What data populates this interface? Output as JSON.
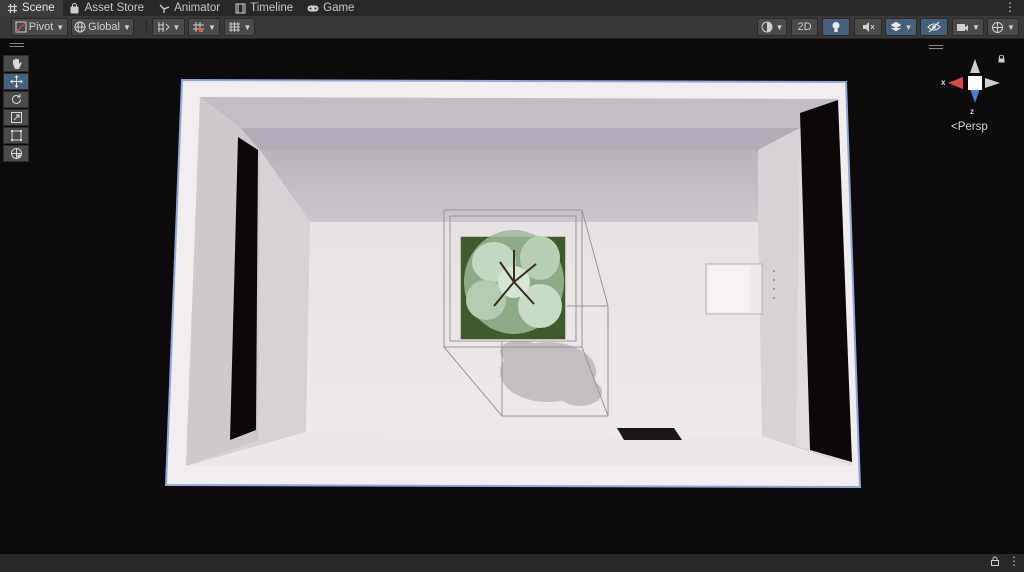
{
  "tabs": [
    {
      "label": "Scene",
      "icon": "grid-icon",
      "active": true
    },
    {
      "label": "Asset Store",
      "icon": "shopping-bag-icon",
      "active": false
    },
    {
      "label": "Animator",
      "icon": "animator-icon",
      "active": false
    },
    {
      "label": "Timeline",
      "icon": "film-icon",
      "active": false
    },
    {
      "label": "Game",
      "icon": "gamepad-icon",
      "active": false
    }
  ],
  "toolbar": {
    "pivot_label": "Pivot",
    "global_label": "Global",
    "mode_2d_label": "2D"
  },
  "tools": [
    "hand-tool",
    "move-tool",
    "rotate-tool",
    "scale-tool",
    "rect-tool",
    "transform-tool"
  ],
  "active_tool": "move-tool",
  "gizmo": {
    "projection_label": "Persp",
    "x_label": "x",
    "z_label": "z"
  },
  "colors": {
    "accent": "#46607c",
    "gizmo_x": "#d84a4a",
    "gizmo_y": "#cfcfcf",
    "gizmo_z": "#4a7fd8"
  }
}
